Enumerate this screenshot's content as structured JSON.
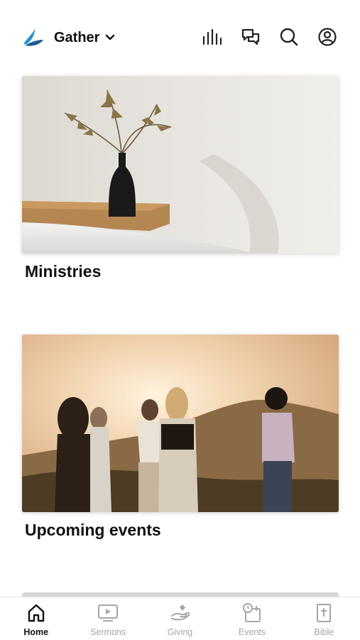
{
  "header": {
    "app_name": "Gather",
    "icons": [
      "listen-icon",
      "messages-icon",
      "search-icon",
      "profile-icon"
    ]
  },
  "cards": [
    {
      "title": "Ministries"
    },
    {
      "title": "Upcoming events"
    }
  ],
  "tabbar": {
    "active": "Home",
    "tabs": [
      {
        "label": "Home",
        "icon": "home-icon"
      },
      {
        "label": "Sermons",
        "icon": "video-play-icon"
      },
      {
        "label": "Giving",
        "icon": "giving-hand-icon"
      },
      {
        "label": "Events",
        "icon": "calendar-clock-icon"
      },
      {
        "label": "Bible",
        "icon": "bible-icon"
      }
    ]
  },
  "colors": {
    "accent_logo": "#1e6fa8",
    "text": "#111111",
    "inactive_tab": "#a6a6a6"
  }
}
